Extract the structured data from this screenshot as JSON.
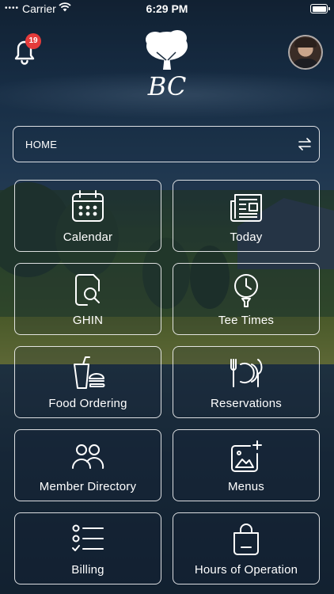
{
  "status_bar": {
    "carrier": "Carrier",
    "time": "6:29 PM"
  },
  "header": {
    "notification_count": "19",
    "logo_text": "BC"
  },
  "selector": {
    "label": "HOME"
  },
  "tiles": [
    {
      "label": "Calendar",
      "icon": "calendar-icon"
    },
    {
      "label": "Today",
      "icon": "newspaper-icon"
    },
    {
      "label": "GHIN",
      "icon": "search-document-icon"
    },
    {
      "label": "Tee Times",
      "icon": "golf-tee-icon"
    },
    {
      "label": "Food Ordering",
      "icon": "food-drink-icon"
    },
    {
      "label": "Reservations",
      "icon": "dining-plate-icon"
    },
    {
      "label": "Member Directory",
      "icon": "people-icon"
    },
    {
      "label": "Menus",
      "icon": "image-add-icon"
    },
    {
      "label": "Billing",
      "icon": "checklist-icon"
    },
    {
      "label": "Hours of Operation",
      "icon": "shopping-bag-icon"
    }
  ],
  "colors": {
    "badge": "#e53b3b",
    "tile_border": "#ffffff"
  }
}
